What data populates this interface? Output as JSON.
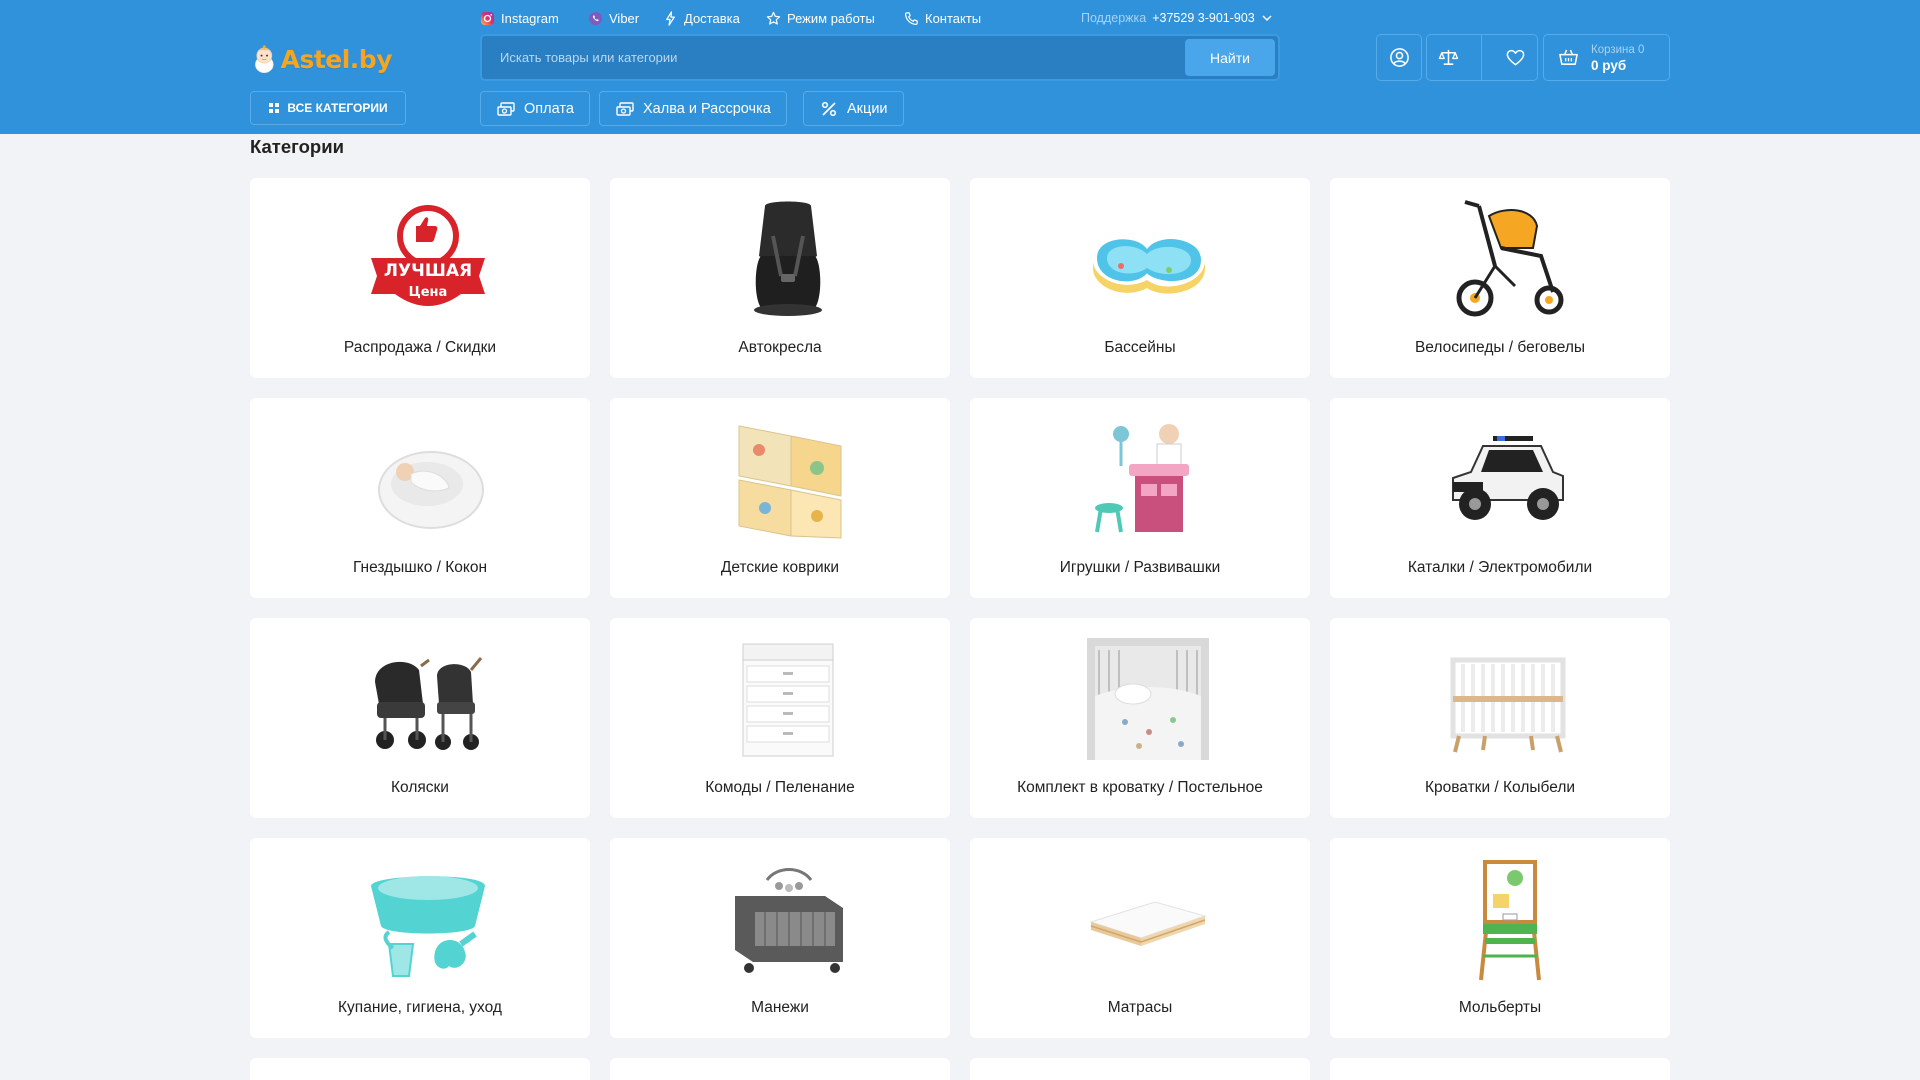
{
  "topbar": {
    "links": [
      {
        "label": "Instagram",
        "icon": "instagram-icon"
      },
      {
        "label": "Viber",
        "icon": "viber-icon"
      },
      {
        "label": "Доставка",
        "icon": "lightning-icon"
      },
      {
        "label": "Режим работы",
        "icon": "star-icon"
      },
      {
        "label": "Контакты",
        "icon": "phone-icon"
      }
    ],
    "support_label": "Поддержка",
    "support_phone": "+37529 3-901-903"
  },
  "logo": {
    "text": "Astel.by"
  },
  "search": {
    "placeholder": "Искать товары или категории",
    "button_label": "Найти"
  },
  "header_actions": {
    "account_icon": "user-icon",
    "compare_icon": "scales-icon",
    "favorites_icon": "heart-icon",
    "cart_icon": "basket-icon",
    "cart_count_label": "Корзина 0",
    "cart_sum": "0 руб"
  },
  "nav": {
    "all_categories": "ВСЕ КАТЕГОРИИ",
    "buttons": [
      {
        "label": "Оплата",
        "icon": "money-icon"
      },
      {
        "label": "Халва и Рассрочка",
        "icon": "money-icon"
      },
      {
        "label": "Акции",
        "icon": "percent-icon"
      }
    ]
  },
  "categories": {
    "title": "Категории",
    "items": [
      {
        "label": "Распродажа / Скидки",
        "image": "best-price-badge-image"
      },
      {
        "label": "Автокресла",
        "image": "car-seat-image"
      },
      {
        "label": "Бассейны",
        "image": "inflatable-pool-image"
      },
      {
        "label": "Велосипеды / беговелы",
        "image": "tricycle-image"
      },
      {
        "label": "Гнездышко / Кокон",
        "image": "baby-cocoon-image"
      },
      {
        "label": "Детские коврики",
        "image": "play-mat-image"
      },
      {
        "label": "Игрушки / Развивашки",
        "image": "toy-doctor-set-image"
      },
      {
        "label": "Каталки / Электромобили",
        "image": "electric-car-image"
      },
      {
        "label": "Коляски",
        "image": "stroller-image"
      },
      {
        "label": "Комоды / Пеленание",
        "image": "chest-of-drawers-image"
      },
      {
        "label": "Комплект в кроватку / Постельное",
        "image": "crib-bedding-image"
      },
      {
        "label": "Кроватки / Колыбели",
        "image": "crib-image"
      },
      {
        "label": "Купание, гигиена, уход",
        "image": "baby-bath-image"
      },
      {
        "label": "Манежи",
        "image": "playpen-image"
      },
      {
        "label": "Матрасы",
        "image": "mattress-image"
      },
      {
        "label": "Мольберты",
        "image": "easel-image"
      }
    ]
  },
  "colors": {
    "header_bg": "#2f92db",
    "accent_orange": "#f7a51c",
    "page_bg": "#f2f3f6",
    "card_bg": "#ffffff"
  }
}
